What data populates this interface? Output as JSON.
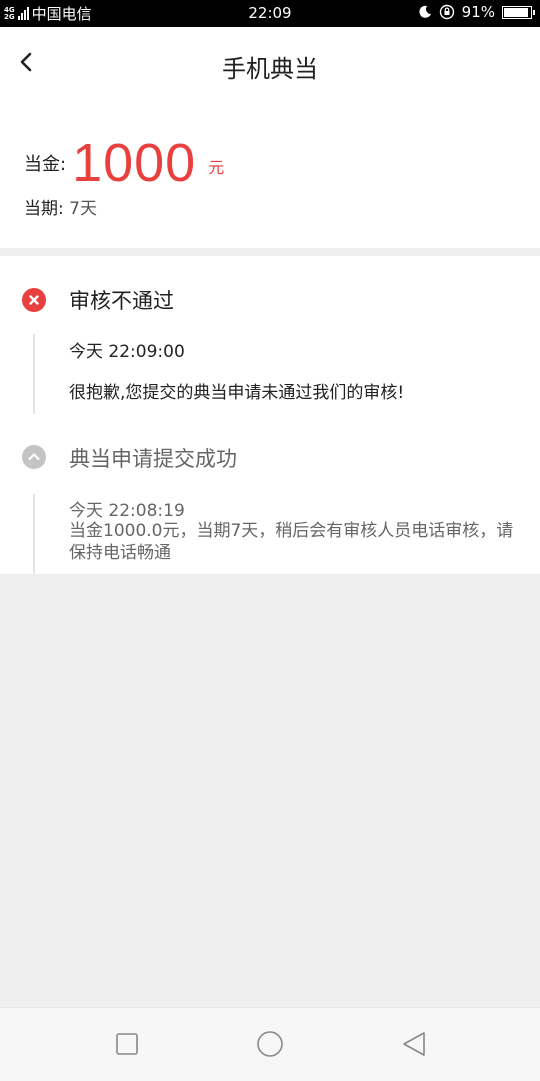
{
  "status_bar": {
    "network_top": "4G",
    "network_bottom": "2G",
    "carrier": "中国电信",
    "time": "22:09",
    "battery_text": "91%",
    "battery_level": 0.91
  },
  "header": {
    "title": "手机典当"
  },
  "summary": {
    "amount_label": "当金:",
    "amount_value": "1000",
    "amount_unit": "元",
    "period_label": "当期:",
    "period_value": "7天"
  },
  "timeline": [
    {
      "status": "fail",
      "title": "审核不通过",
      "time": "今天 22:09:00",
      "message": "很抱歉,您提交的典当申请未通过我们的审核!"
    },
    {
      "status": "ok",
      "title": "典当申请提交成功",
      "time": "今天 22:08:19",
      "message": "当金1000.0元，当期7天，稍后会有审核人员电话审核，请保持电话畅通"
    }
  ],
  "colors": {
    "accent": "#e8403f",
    "muted_icon": "#c4c4c4",
    "page_bg": "#efefef"
  }
}
